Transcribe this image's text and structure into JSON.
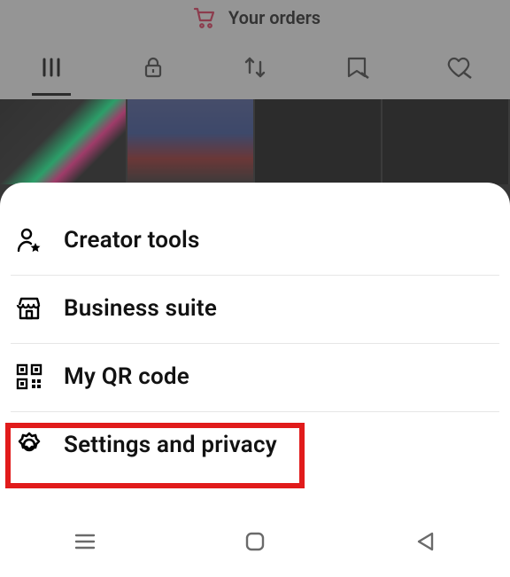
{
  "header": {
    "orders_label": "Your orders"
  },
  "menu": {
    "items": [
      {
        "id": "creator-tools",
        "label": "Creator tools"
      },
      {
        "id": "business-suite",
        "label": "Business suite"
      },
      {
        "id": "qr-code",
        "label": "My QR code"
      },
      {
        "id": "settings-privacy",
        "label": "Settings and privacy"
      }
    ]
  },
  "highlight": {
    "target": "settings-privacy"
  },
  "colors": {
    "highlight": "#e11b1b",
    "cart": "#d6244a"
  }
}
